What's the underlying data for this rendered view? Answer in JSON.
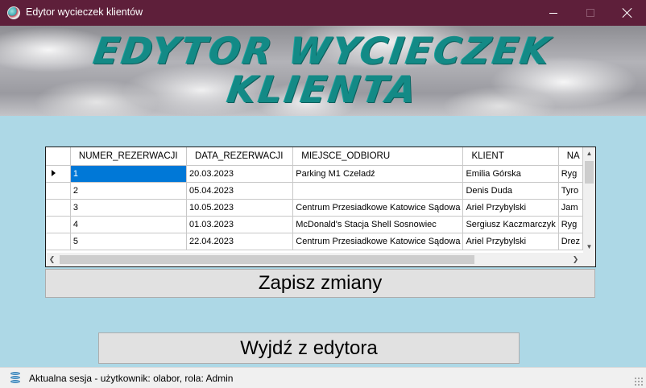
{
  "window": {
    "title": "Edytor wycieczek klientów",
    "titlebar_color": "#5e1f3a"
  },
  "banner": {
    "line1": "EDYTOR WYCIECZEK",
    "line2": "KLIENTA",
    "text_color": "#138a86"
  },
  "grid": {
    "columns": [
      "NUMER_REZERWACJI",
      "DATA_REZERWACJI",
      "MIEJSCE_ODBIORU",
      "KLIENT",
      "NA"
    ],
    "rows": [
      [
        "1",
        "20.03.2023",
        "Parking M1 Czeladź",
        "Emilia Górska",
        "Ryg"
      ],
      [
        "2",
        "05.04.2023",
        "",
        "Denis Duda",
        "Tyro"
      ],
      [
        "3",
        "10.05.2023",
        "Centrum Przesiadkowe Katowice Sądowa",
        "Ariel Przybylski",
        "Jam"
      ],
      [
        "4",
        "01.03.2023",
        "McDonald's Stacja Shell Sosnowiec",
        "Sergiusz Kaczmarczyk",
        "Ryg"
      ],
      [
        "5",
        "22.04.2023",
        "Centrum Przesiadkowe Katowice Sądowa",
        "Ariel Przybylski",
        "Drez"
      ]
    ],
    "current_row": 0,
    "selected_cell_color": "#0078d7"
  },
  "buttons": {
    "save_label": "Zapisz zmiany",
    "exit_label": "Wyjdź z edytora"
  },
  "statusbar": {
    "text": "Aktualna sesja - użytkownik: olabor, rola: Admin",
    "icon": "database-icon"
  },
  "background_color": "#add8e6"
}
